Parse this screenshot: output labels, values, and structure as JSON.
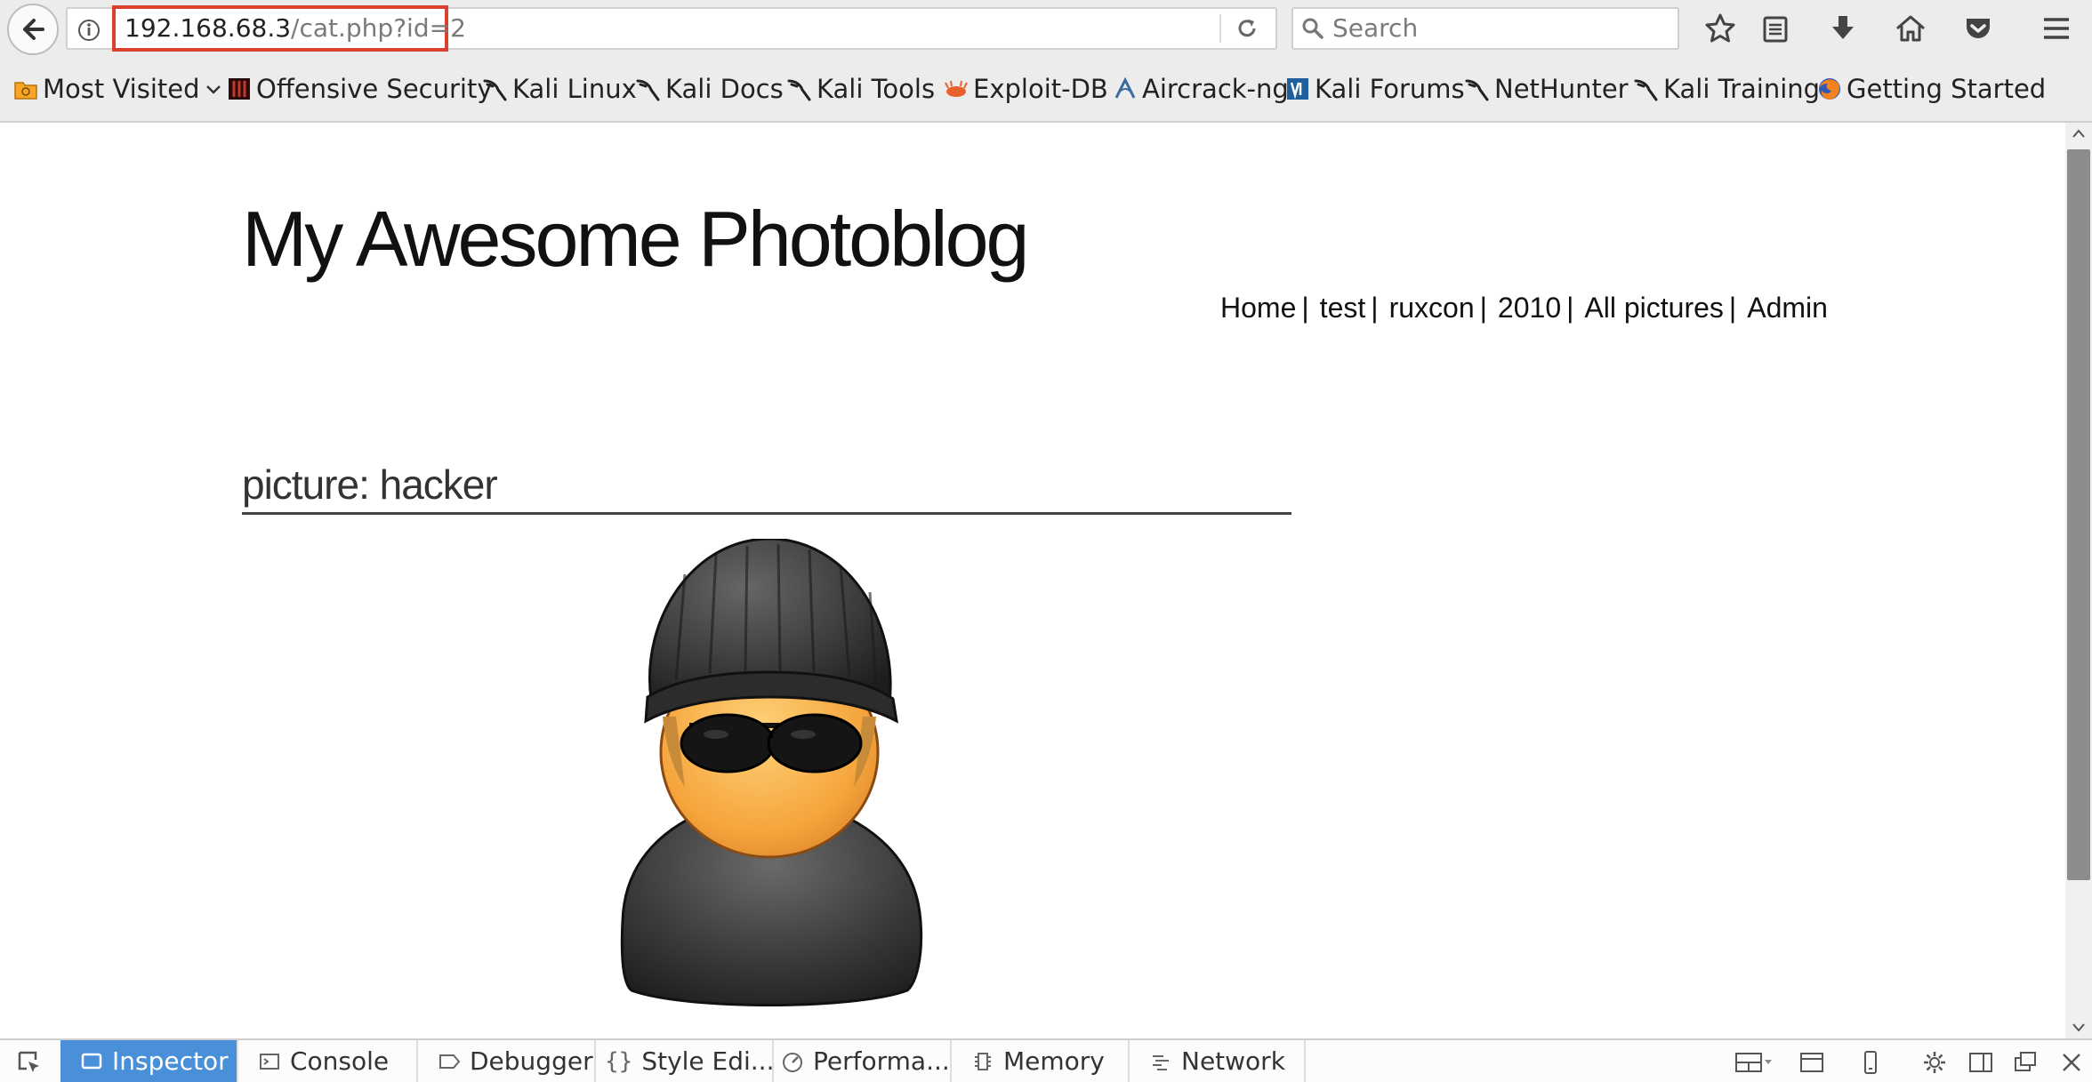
{
  "browser": {
    "url_host": "192.168.68.3",
    "url_path": "/cat.php?id=2",
    "search_placeholder": "Search"
  },
  "bookmarks": [
    {
      "label": "Most Visited",
      "icon": "folder-icon"
    },
    {
      "label": "Offensive Security",
      "icon": "offsec-icon"
    },
    {
      "label": "Kali Linux",
      "icon": "kali-icon"
    },
    {
      "label": "Kali Docs",
      "icon": "kali-icon"
    },
    {
      "label": "Kali Tools",
      "icon": "kali-icon"
    },
    {
      "label": "Exploit-DB",
      "icon": "exploitdb-icon"
    },
    {
      "label": "Aircrack-ng",
      "icon": "aircrack-icon"
    },
    {
      "label": "Kali Forums",
      "icon": "forum-icon"
    },
    {
      "label": "NetHunter",
      "icon": "kali-icon"
    },
    {
      "label": "Kali Training",
      "icon": "kali-icon"
    },
    {
      "label": "Getting Started",
      "icon": "firefox-icon"
    }
  ],
  "page": {
    "title": "My Awesome Photoblog",
    "nav": [
      "Home",
      "test",
      "ruxcon",
      "2010",
      "All pictures",
      "Admin"
    ],
    "nav_separator": "|",
    "picture_heading": "picture: hacker"
  },
  "devtools": {
    "tabs": [
      {
        "label": "Inspector",
        "active": true
      },
      {
        "label": "Console",
        "active": false
      },
      {
        "label": "Debugger",
        "active": false
      },
      {
        "label": "Style Edi...",
        "active": false
      },
      {
        "label": "Performa...",
        "active": false
      },
      {
        "label": "Memory",
        "active": false
      },
      {
        "label": "Network",
        "active": false
      }
    ]
  },
  "colors": {
    "url_highlight": "#d9412e",
    "devtools_active": "#4a90d9"
  }
}
